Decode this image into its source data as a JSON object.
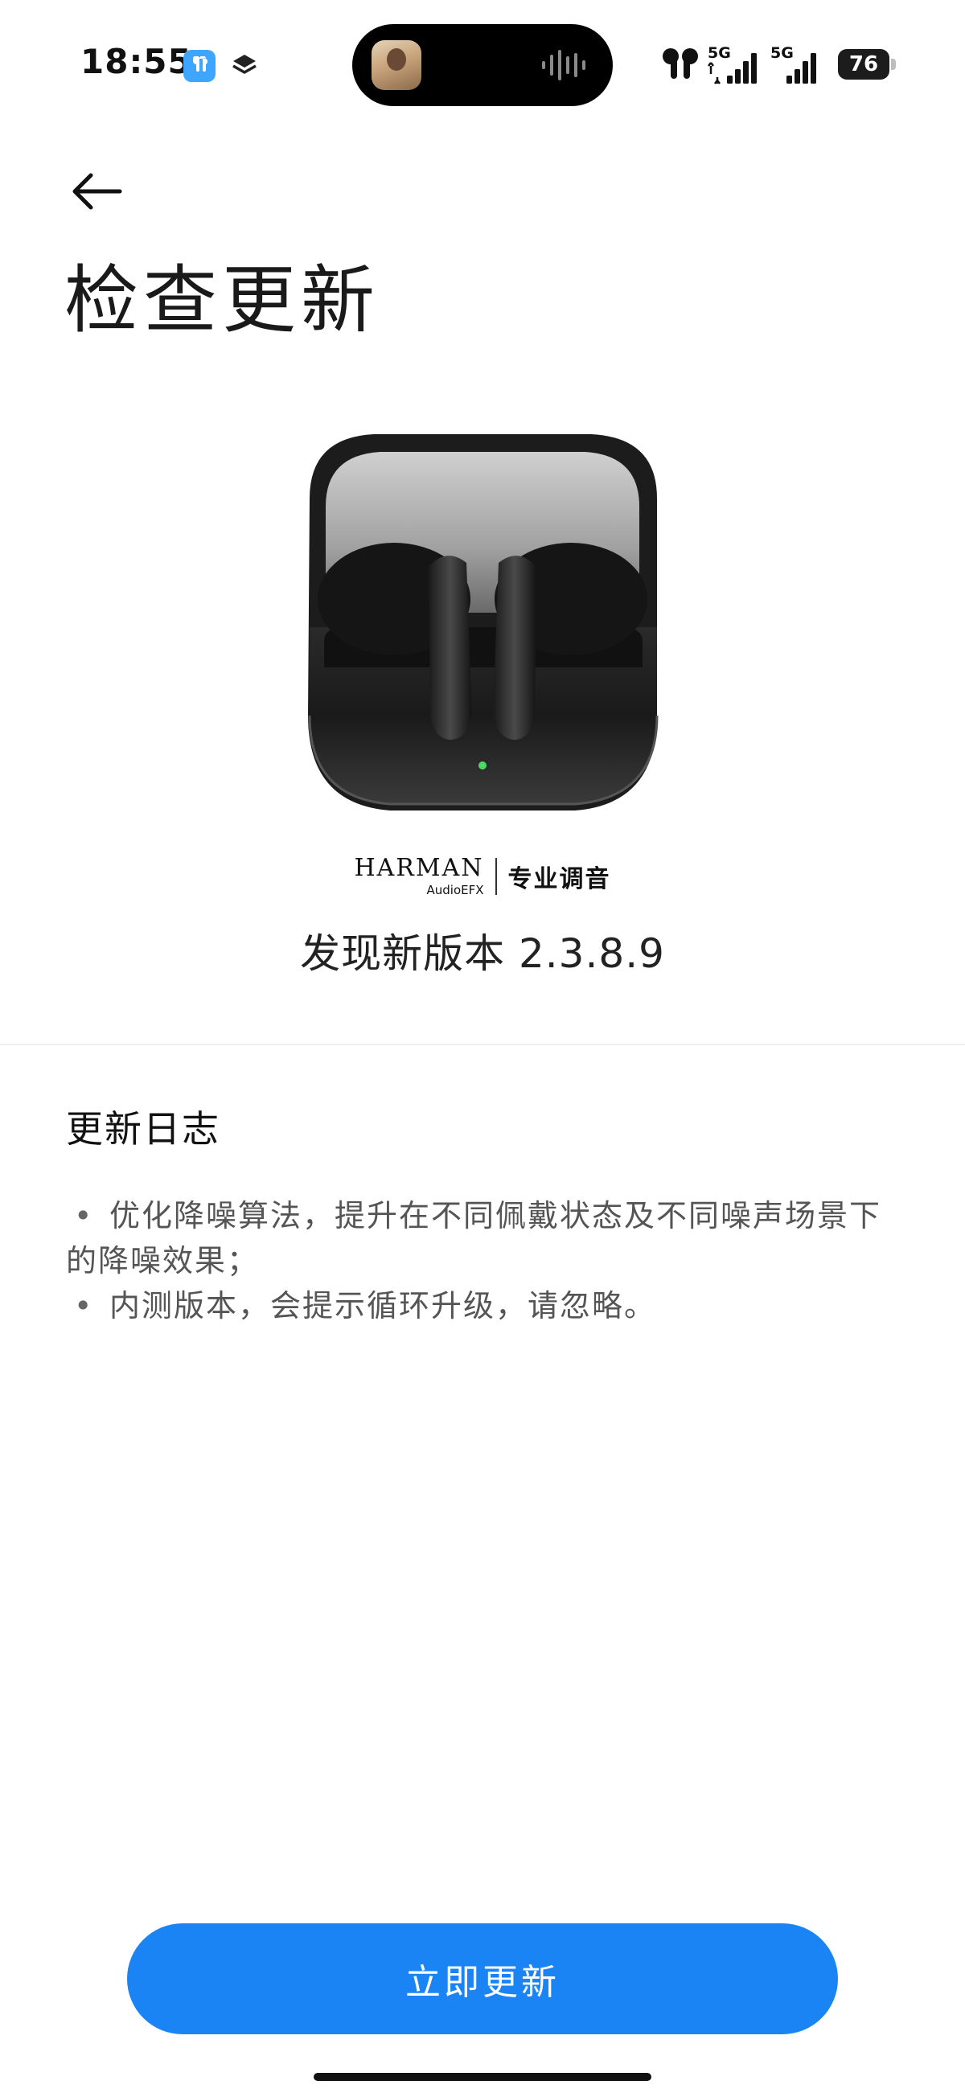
{
  "status_bar": {
    "time": "18:55",
    "network_1": "5G",
    "network_2": "5G",
    "battery": "76",
    "icons": [
      "earbuds-app-icon",
      "layers-icon",
      "earbuds-icon",
      "signal-icon",
      "battery-icon"
    ]
  },
  "header": {
    "back_icon": "arrow-left-icon",
    "title": "检查更新"
  },
  "product": {
    "brand_name": "HARMAN",
    "brand_sub": "AudioEFX",
    "brand_tuning": "专业调音",
    "version_text": "发现新版本 2.3.8.9"
  },
  "changelog": {
    "title": "更新日志",
    "items": [
      "优化降噪算法，提升在不同佩戴状态及不同噪声场景下的降噪效果；",
      "内测版本，会提示循环升级，请忽略。"
    ]
  },
  "actions": {
    "update_label": "立即更新"
  },
  "colors": {
    "accent": "#1a84f5",
    "background": "#ffffff",
    "text_primary": "#111111",
    "text_secondary": "#555555"
  }
}
